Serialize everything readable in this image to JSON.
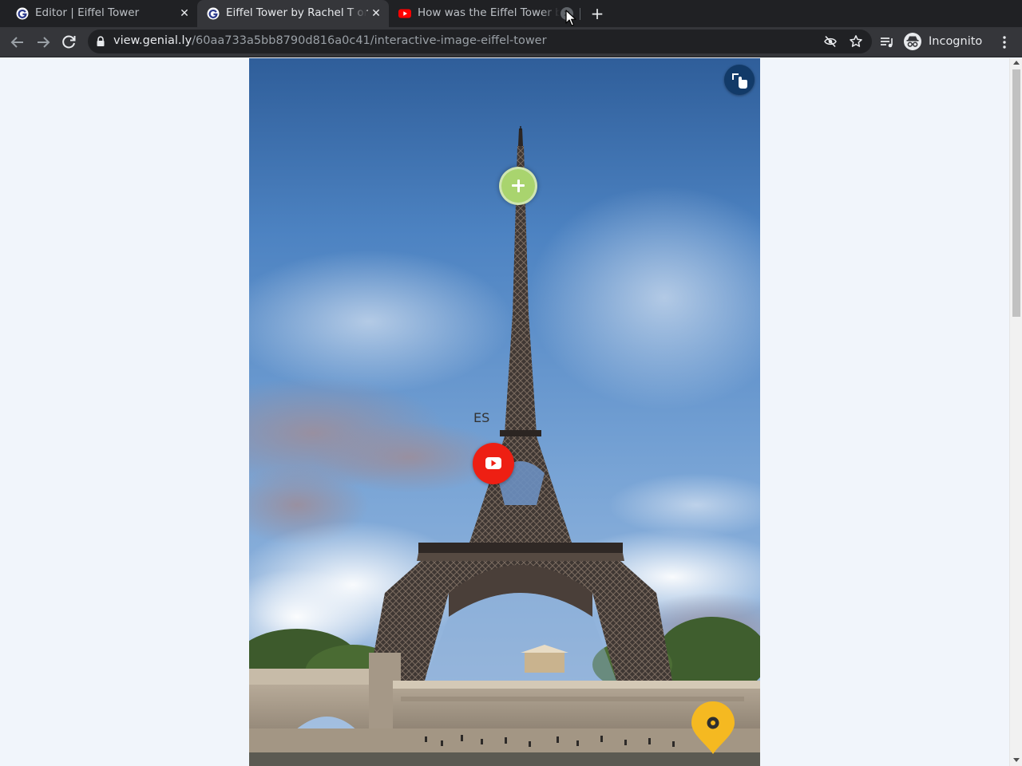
{
  "browser": {
    "tabs": [
      {
        "title": "Editor | Eiffel Tower",
        "favicon": "genially-icon",
        "active": false
      },
      {
        "title": "Eiffel Tower by Rachel T on Genially",
        "favicon": "genially-icon",
        "active": true
      },
      {
        "title": "How was the Eiffel Tower built?",
        "favicon": "youtube-icon",
        "active": false
      }
    ],
    "close_glyph": "✕",
    "new_tab_glyph": "+",
    "url_host": "view.genial.ly",
    "url_path": "/60aa733a5bb8790d816a0c41/interactive-image-eiffel-tower",
    "profile_label": "Incognito"
  },
  "page": {
    "partial_label": "ES",
    "hotspots": [
      {
        "icon": "plus-icon",
        "color": "#a9d46e"
      },
      {
        "icon": "youtube-play-icon",
        "color": "#ee1f13"
      },
      {
        "icon": "map-pin-icon",
        "color": "#f5b921"
      }
    ],
    "fullscreen_button_color": "#123a68"
  },
  "colors": {
    "tabstrip_bg": "#202124",
    "toolbar_bg": "#35363a",
    "page_bg": "#f1f5fb"
  }
}
